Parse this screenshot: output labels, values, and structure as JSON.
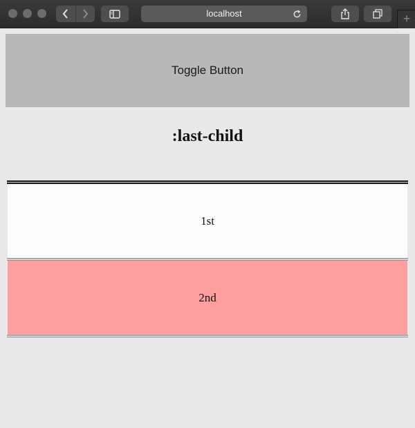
{
  "browser": {
    "url": "localhost",
    "new_tab_symbol": "+"
  },
  "page": {
    "toggle_button_label": "Toggle Button",
    "heading": ":last-child",
    "items": [
      {
        "label": "1st",
        "bg": "#fdfcff"
      },
      {
        "label": "2nd",
        "bg": "#ff9e9f"
      }
    ]
  }
}
